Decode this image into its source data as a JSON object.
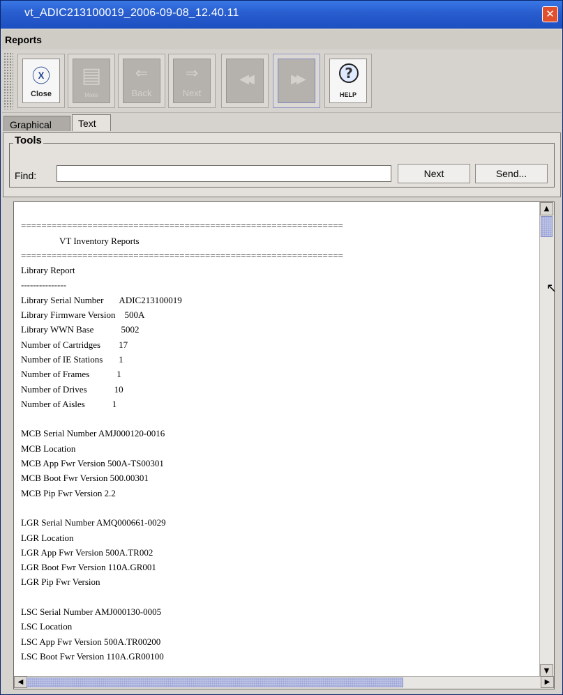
{
  "window": {
    "title": "vt_ADIC213100019_2006-09-08_12.40.11",
    "close_glyph": "✕"
  },
  "menubar": {
    "label": "Reports"
  },
  "toolbar": {
    "buttons": [
      {
        "name": "close-button",
        "label": "Close",
        "icon": "close-icon",
        "glyph": "ⓧ",
        "enabled": true
      },
      {
        "name": "pdf-button",
        "label": "Make",
        "icon": "pdf-icon",
        "glyph": "▤",
        "enabled": false
      },
      {
        "name": "back-button",
        "label": "Back",
        "icon": "arrow-left-icon",
        "glyph": "⇐",
        "enabled": false
      },
      {
        "name": "next-button",
        "label": "Next",
        "icon": "arrow-right-icon",
        "glyph": "⇒",
        "enabled": false
      },
      {
        "name": "rewind-button",
        "label": "",
        "icon": "rewind-icon",
        "glyph": "◀◀",
        "enabled": false
      },
      {
        "name": "forward-button",
        "label": "",
        "icon": "fast-forward-icon",
        "glyph": "▶▶",
        "enabled": false
      },
      {
        "name": "help-button",
        "label": "HELP",
        "icon": "help-icon",
        "glyph": "?",
        "enabled": true
      }
    ]
  },
  "tabs": [
    {
      "label": "Graphical",
      "active": false
    },
    {
      "label": "Text",
      "active": true
    }
  ],
  "tools": {
    "legend": "Tools",
    "find_label": "Find:",
    "find_value": "",
    "next_label": "Next",
    "send_label": "Send..."
  },
  "report": {
    "lines": [
      "",
      "===============================================================",
      "                 VT Inventory Reports",
      "===============================================================",
      "Library Report",
      "---------------",
      "Library Serial Number       ADIC213100019",
      "Library Firmware Version    500A",
      "Library WWN Base            5002",
      "Number of Cartridges        17",
      "Number of IE Stations       1",
      "Number of Frames            1",
      "Number of Drives            10",
      "Number of Aisles            1",
      "",
      "MCB Serial Number AMJ000120-0016",
      "MCB Location",
      "MCB App Fwr Version 500A-TS00301",
      "MCB Boot Fwr Version 500.00301",
      "MCB Pip Fwr Version 2.2",
      "",
      "LGR Serial Number AMQ000661-0029",
      "LGR Location",
      "LGR App Fwr Version 500A.TR002",
      "LGR Boot Fwr Version 110A.GR001",
      "LGR Pip Fwr Version",
      "",
      "LSC Serial Number AMJ000130-0005",
      "LSC Location",
      "LSC App Fwr Version 500A.TR00200",
      "LSC Boot Fwr Version 110A.GR00100"
    ]
  },
  "scroll": {
    "up": "▲",
    "down": "▼",
    "left": "◀",
    "right": "▶"
  },
  "cursor_glyph": "↖"
}
